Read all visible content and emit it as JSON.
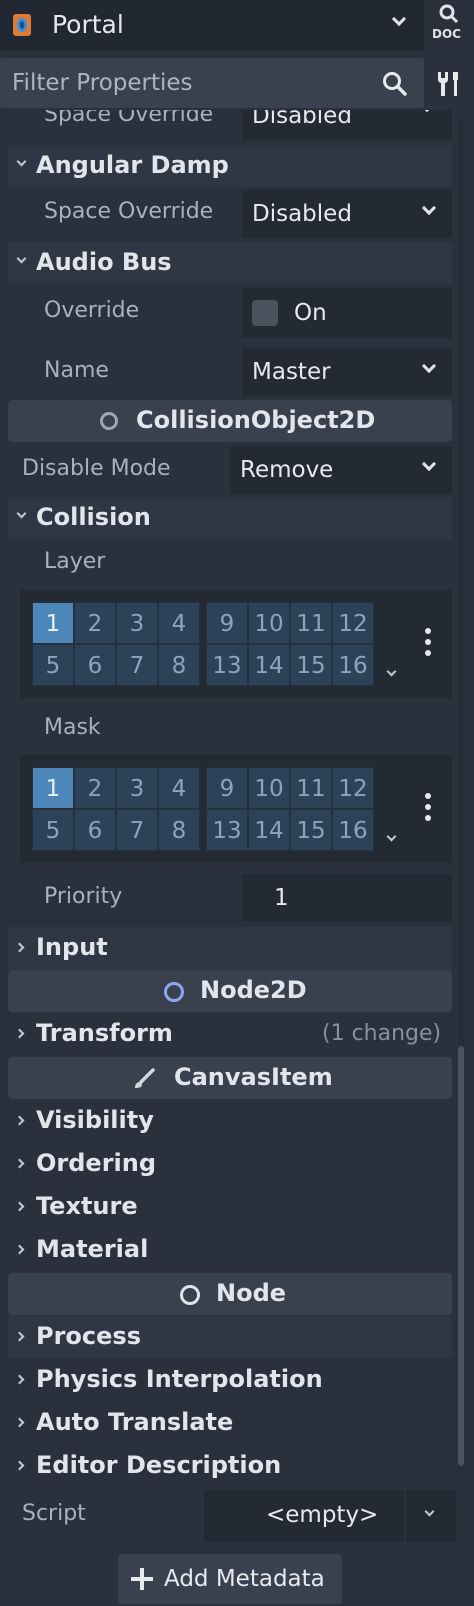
{
  "topbar": {
    "object_name": "Portal",
    "doc_label": "DOC"
  },
  "filter": {
    "placeholder": "Filter Properties"
  },
  "properties": {
    "space_override_partial": {
      "label": "Space Override",
      "value": "Disabled"
    },
    "angular_damp": {
      "title": "Angular Damp",
      "space_override_label": "Space Override",
      "space_override_value": "Disabled"
    },
    "audio_bus": {
      "title": "Audio Bus",
      "override_label": "Override",
      "override_checkbox_text": "On",
      "name_label": "Name",
      "name_value": "Master"
    },
    "collision_object": {
      "title": "CollisionObject2D",
      "disable_mode_label": "Disable Mode",
      "disable_mode_value": "Remove"
    },
    "collision": {
      "title": "Collision",
      "layer_label": "Layer",
      "layer_cells": [
        "1",
        "2",
        "3",
        "4",
        "9",
        "10",
        "11",
        "12",
        "5",
        "6",
        "7",
        "8",
        "13",
        "14",
        "15",
        "16"
      ],
      "layer_selected": [
        "1"
      ],
      "mask_label": "Mask",
      "mask_cells": [
        "1",
        "2",
        "3",
        "4",
        "9",
        "10",
        "11",
        "12",
        "5",
        "6",
        "7",
        "8",
        "13",
        "14",
        "15",
        "16"
      ],
      "mask_selected": [
        "1"
      ],
      "priority_label": "Priority",
      "priority_value": "1"
    },
    "input": {
      "title": "Input"
    },
    "node2d": {
      "title": "Node2D",
      "transform_title": "Transform",
      "transform_changes": "(1 change)"
    },
    "canvas_item": {
      "title": "CanvasItem",
      "visibility": "Visibility",
      "ordering": "Ordering",
      "texture": "Texture",
      "material": "Material"
    },
    "node": {
      "title": "Node",
      "process": "Process",
      "physics_interpolation": "Physics Interpolation",
      "auto_translate": "Auto Translate",
      "editor_description": "Editor Description"
    },
    "script": {
      "label": "Script",
      "value": "<empty>"
    }
  },
  "footer": {
    "add_metadata": "Add Metadata"
  },
  "colors": {
    "background": "#2a303c",
    "section": "#303744",
    "class_header": "#3a414e",
    "cell_on": "#4d86b8",
    "cell_off": "#2c4258",
    "node2d_icon": "#8da5f3"
  }
}
